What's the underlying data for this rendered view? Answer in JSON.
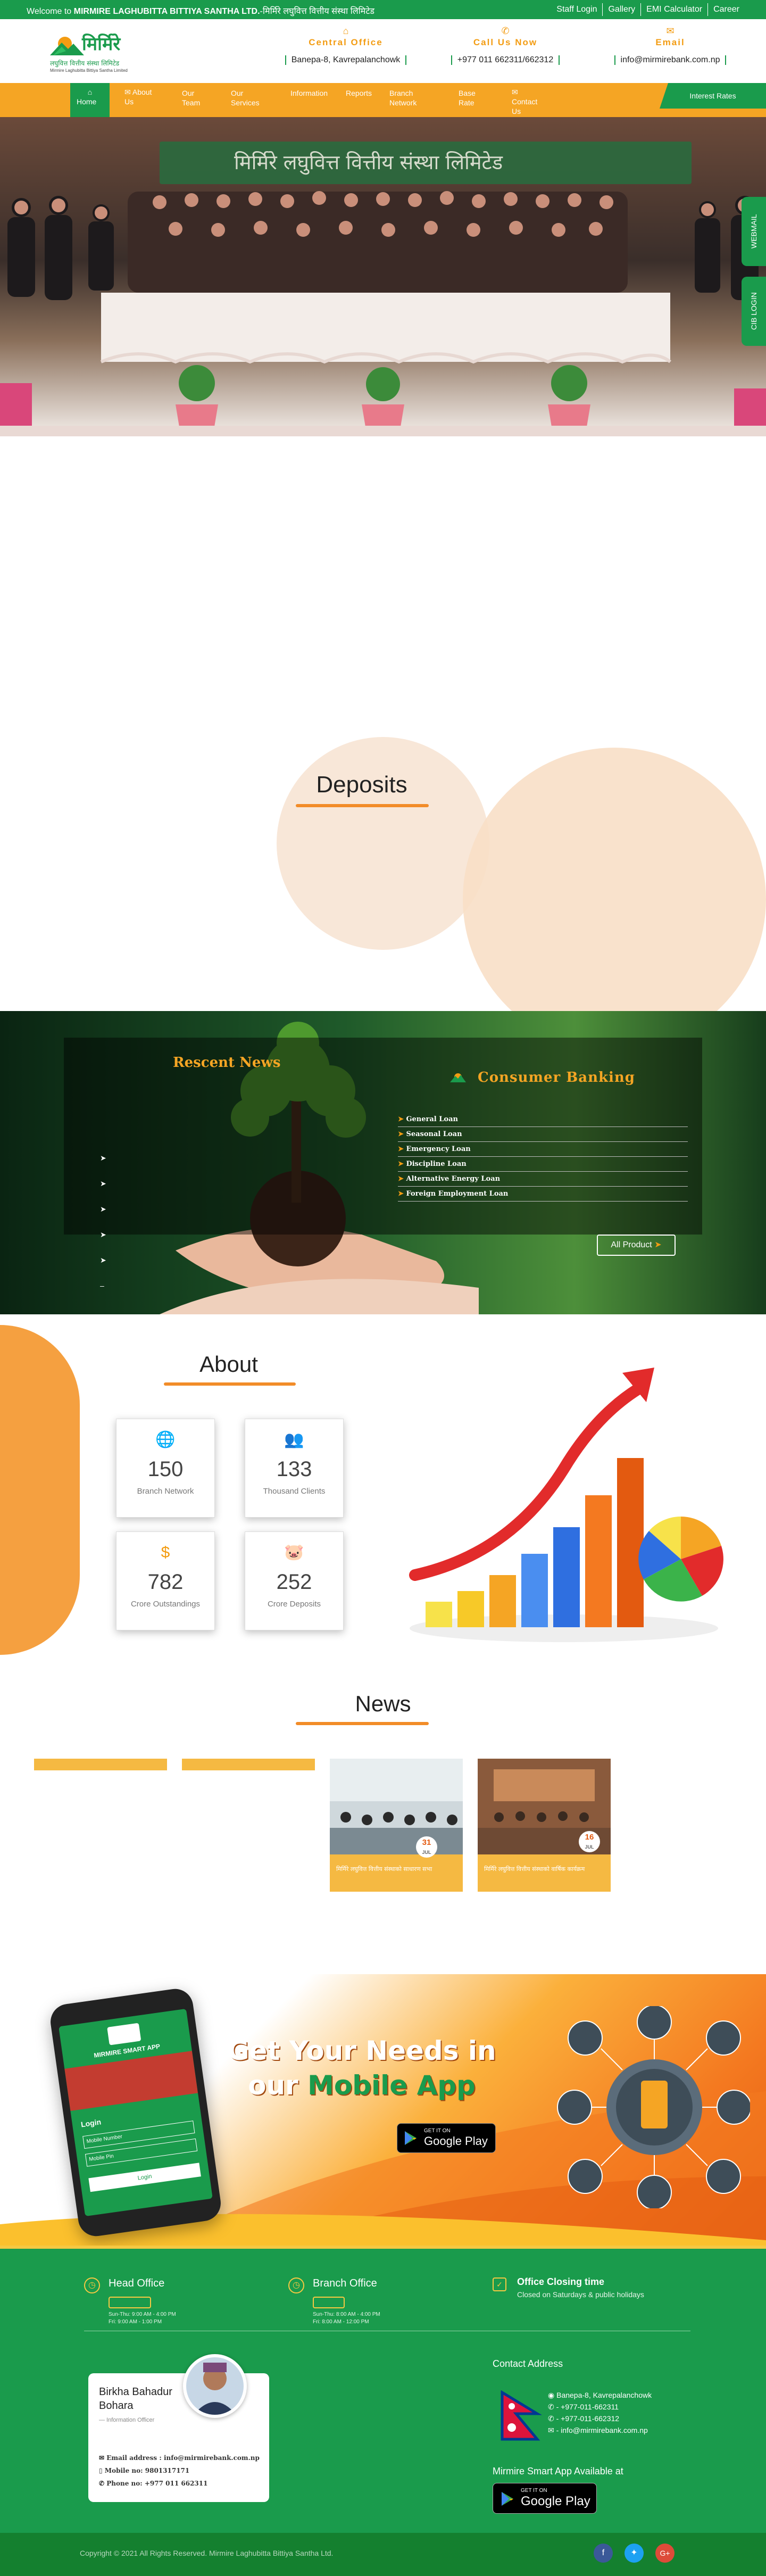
{
  "topbar": {
    "welcome_prefix": "Welcome to ",
    "welcome_name": "MIRMIRE LAGHUBITTA BITTIYA SANTHA LTD.",
    "welcome_suffix": "-मिर्मिरे लघुवित्त वित्तीय संस्था लिमिटेड",
    "links": [
      "Staff Login",
      "Gallery",
      "EMI Calculator",
      "Career"
    ]
  },
  "logo": {
    "devanagari": "मिर्मिरे",
    "line2": "लघुवित्त वित्तीय संस्था लिमिटेड",
    "line3": "Mirmire Laghubitta Bittiya Santha Limited"
  },
  "header": {
    "office_title": "Central Office",
    "office_value": "Banepa-8, Kavrepalanchowk",
    "call_title": "Call Us Now",
    "call_value": "+977 011 662311/662312",
    "email_title": "Email",
    "email_value": "info@mirmirebank.com.np"
  },
  "nav": {
    "items": [
      "Home",
      "About Us",
      "Our Team",
      "Our Services",
      "Information",
      "Reports",
      "Branch Network",
      "Base Rate",
      "Contact Us"
    ],
    "interest": "Interest Rates"
  },
  "side_tabs": [
    "WEBMAIL",
    "CIB LOGIN"
  ],
  "hero": {
    "banner_text": "मिर्मिरे लघुवित्त वित्तीय संस्था लिमिटेड"
  },
  "deposits": {
    "title": "Deposits"
  },
  "band": {
    "news_title": "Rescent News",
    "banking_title": "Consumer Banking",
    "loans": [
      "General Loan",
      "Seasonal Loan",
      "Emergency Loan",
      "Discipline Loan",
      "Alternative Energy Loan",
      "Foreign Employment Loan"
    ],
    "all_product": "All Product"
  },
  "about": {
    "title": "About",
    "stats": [
      {
        "icon": "globe-icon",
        "value": "150",
        "label": "Branch Network"
      },
      {
        "icon": "users-icon",
        "value": "133",
        "label": "Thousand Clients"
      },
      {
        "icon": "money-hand-icon",
        "value": "782",
        "label": "Crore Outstandings"
      },
      {
        "icon": "piggy-bank-icon",
        "value": "252",
        "label": "Crore Deposits"
      }
    ]
  },
  "news": {
    "title": "News",
    "cards": [
      {
        "day": "31",
        "month": "JUL",
        "caption": "मिर्मिरे लघुवित्त वित्तीय संस्थाको साधारण सभा"
      },
      {
        "day": "16",
        "month": "JUL",
        "caption": "मिर्मिरे लघुवित्त वित्तीय संस्थाको वार्षिक कार्यक्रम"
      }
    ]
  },
  "app": {
    "line1": "Get Your Needs in",
    "line2a": "our ",
    "line2b": "Mobile App",
    "play_small": "GET IT ON",
    "play_big": "Google Play",
    "phone_title": "MIRMIRE SMART APP",
    "phone_login": "Login",
    "phone_user": "Mobile Number",
    "phone_pass": "Mobile Pin",
    "phone_btn": "Login"
  },
  "footer": {
    "head_title": "Head Office",
    "head_hours1": "Sun-Thu: 9:00 AM - 4:00 PM",
    "head_hours2": "Fri: 9:00 AM - 1:00 PM",
    "branch_title": "Branch Office",
    "branch_hours1": "Sun-Thu: 8:00 AM - 4:00 PM",
    "branch_hours2": "Fri: 8:00 AM - 12:00 PM",
    "closing_title": "Office Closing time",
    "closing_text": "Closed on Saturdays & public holidays",
    "officer_name": "Birkha Bahadur Bohara",
    "officer_role": "— Information Officer",
    "officer_email_label": "Email address : ",
    "officer_email": "info@mirmirebank.com.np",
    "officer_mobile_label": "Mobile no: ",
    "officer_mobile": "9801317171",
    "officer_phone_label": "Phone no: ",
    "officer_phone": "+977 011 662311",
    "contact_title": "Contact Address",
    "contact_lines": [
      "Banepa-8, Kavrepalanchowk",
      "- +977-011-662311",
      "- +977-011-662312",
      "- info@mirmirebank.com.np"
    ],
    "app_title": "Mirmire Smart App Available at",
    "play_small": "GET IT ON",
    "play_big": "Google Play"
  },
  "copyright": "Copyright © 2021 All Rights Reserved. Mirmire Laghubitta Bittiya Santha Ltd.",
  "colors": {
    "green": "#1a9b4c",
    "orange": "#f5a524",
    "accent": "#f28c28"
  }
}
